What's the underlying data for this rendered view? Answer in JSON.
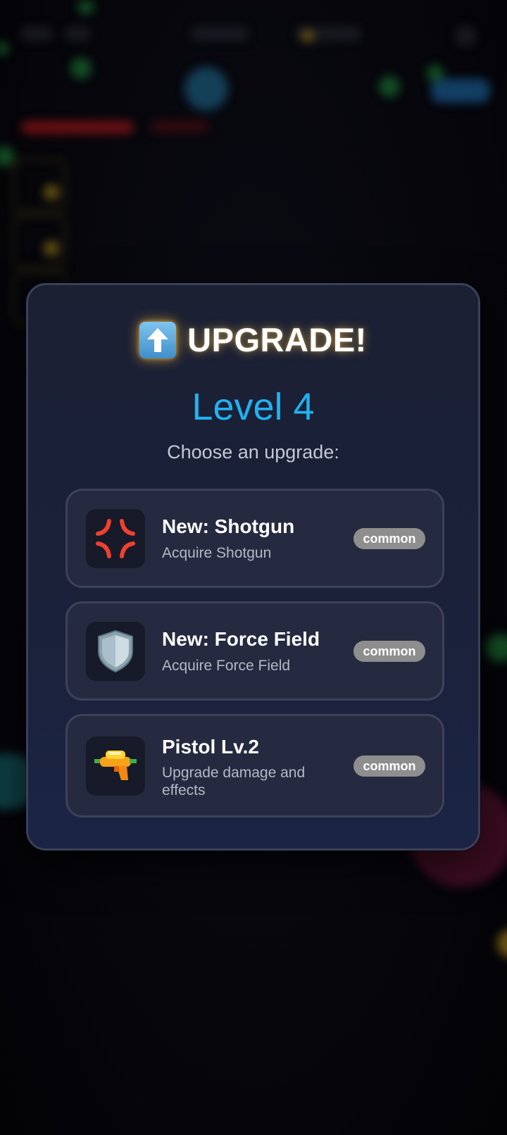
{
  "dialog": {
    "title": "UPGRADE!",
    "title_icon": "up-arrow-icon",
    "level": "Level 4",
    "prompt": "Choose an upgrade:"
  },
  "options": [
    {
      "name": "New: Shotgun",
      "description": "Acquire Shotgun",
      "rarity": "common",
      "icon": "anger-symbol-icon"
    },
    {
      "name": "New: Force Field",
      "description": "Acquire Force Field",
      "rarity": "common",
      "icon": "shield-icon"
    },
    {
      "name": "Pistol Lv.2",
      "description": "Upgrade damage and effects",
      "rarity": "common",
      "icon": "water-pistol-icon"
    }
  ],
  "colors": {
    "level": "#1fb2f2",
    "badge_common": "#8e8e8e",
    "card_bg": "#252a40",
    "dialog_border": "#3a4156"
  }
}
